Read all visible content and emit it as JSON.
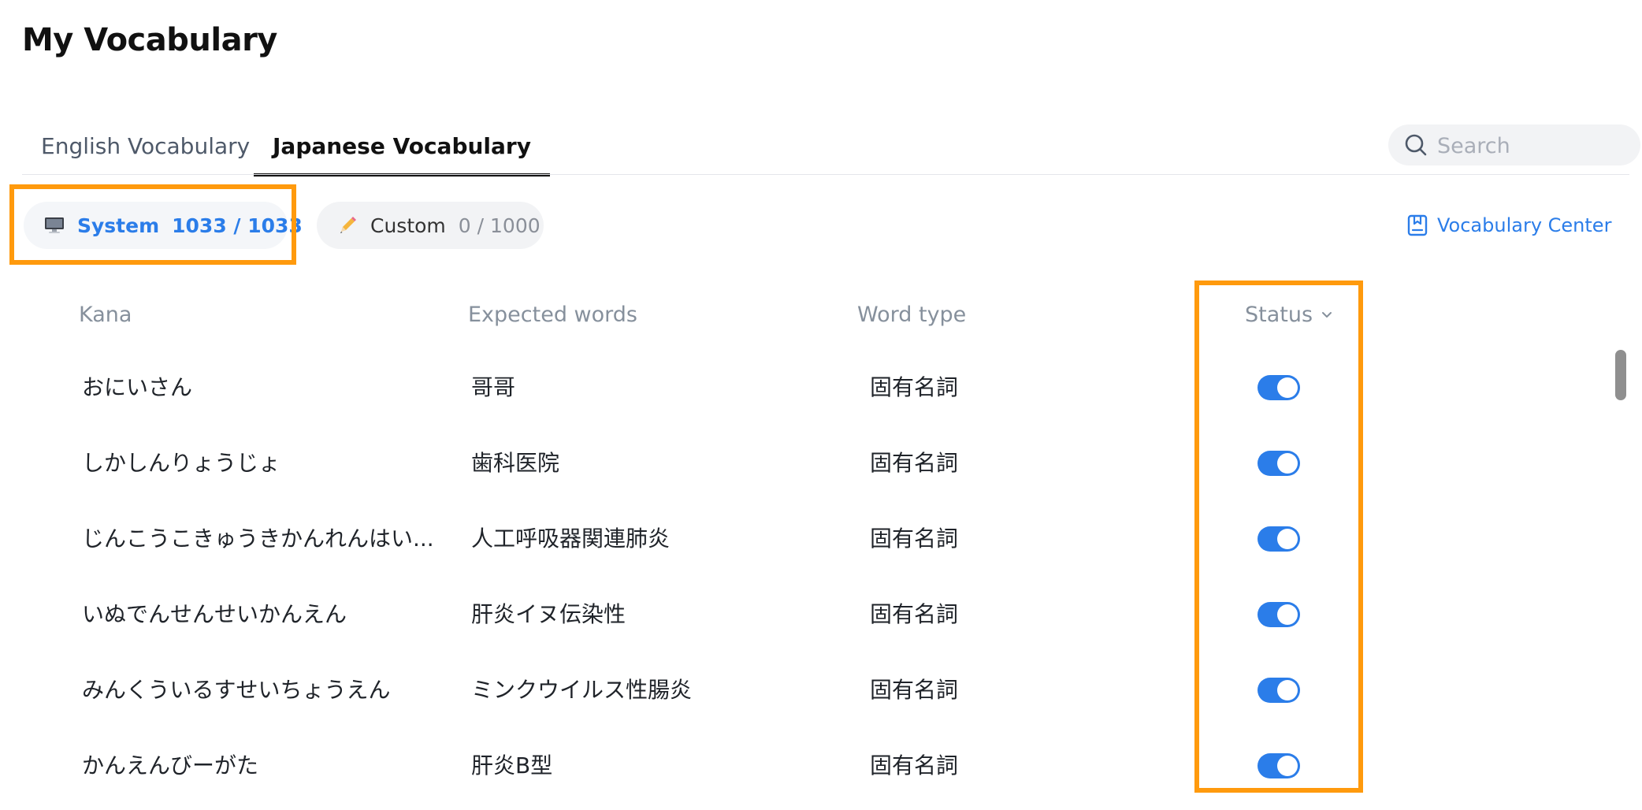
{
  "page": {
    "title": "My Vocabulary"
  },
  "tabs": [
    {
      "label": "English Vocabulary",
      "active": false
    },
    {
      "label": "Japanese Vocabulary",
      "active": true
    }
  ],
  "search": {
    "placeholder": "Search",
    "value": ""
  },
  "filters": {
    "system": {
      "label": "System",
      "count": "1033 / 1033",
      "icon": "monitor-icon",
      "selected": true
    },
    "custom": {
      "label": "Custom",
      "count": "0 / 1000",
      "icon": "pencil-icon",
      "selected": false
    }
  },
  "vocabulary_center": {
    "label": "Vocabulary Center",
    "icon": "book-icon"
  },
  "table": {
    "headers": {
      "kana": "Kana",
      "expected": "Expected words",
      "type": "Word type",
      "status": "Status"
    },
    "rows": [
      {
        "kana": "おにいさん",
        "expected": "哥哥",
        "type": "固有名詞",
        "enabled": true
      },
      {
        "kana": "しかしんりょうじょ",
        "expected": "歯科医院",
        "type": "固有名詞",
        "enabled": true
      },
      {
        "kana": "じんこうこきゅうきかんれんはい...",
        "expected": "人工呼吸器関連肺炎",
        "type": "固有名詞",
        "enabled": true
      },
      {
        "kana": "いぬでんせんせいかんえん",
        "expected": "肝炎イヌ伝染性",
        "type": "固有名詞",
        "enabled": true
      },
      {
        "kana": "みんくういるすせいちょうえん",
        "expected": "ミンクウイルス性腸炎",
        "type": "固有名詞",
        "enabled": true
      },
      {
        "kana": "かんえんびーがた",
        "expected": "肝炎B型",
        "type": "固有名詞",
        "enabled": true
      }
    ]
  },
  "colors": {
    "accent": "#2b7de9",
    "highlight": "#ff9a0d"
  }
}
